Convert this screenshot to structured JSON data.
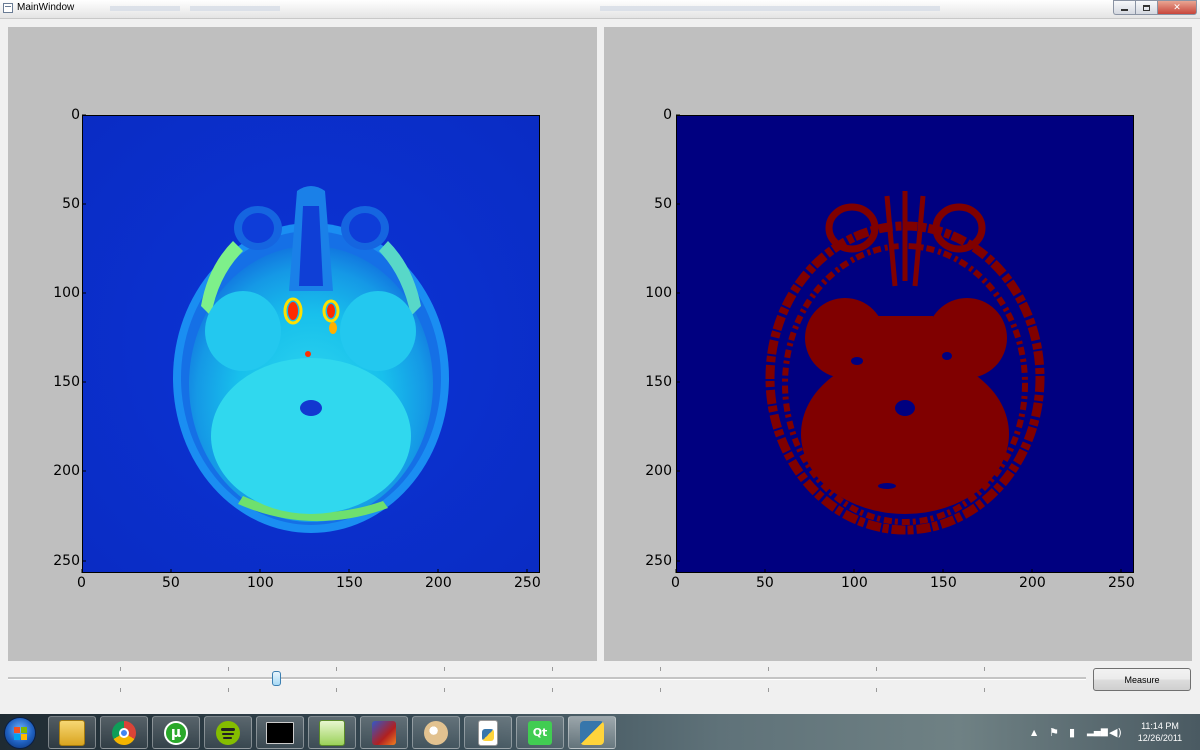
{
  "window": {
    "title": "MainWindow"
  },
  "plots": [
    {
      "name": "mri-original",
      "x_ticks": [
        "0",
        "50",
        "100",
        "150",
        "200",
        "250"
      ],
      "y_ticks": [
        "0",
        "50",
        "100",
        "150",
        "200",
        "250"
      ],
      "colormap": "jet",
      "background_color": "#0b2fcf"
    },
    {
      "name": "mri-threshold",
      "x_ticks": [
        "0",
        "50",
        "100",
        "150",
        "200",
        "250"
      ],
      "y_ticks": [
        "0",
        "50",
        "100",
        "150",
        "200",
        "250"
      ],
      "colormap": "binary-jet",
      "background_color": "#000080",
      "foreground_color": "#800000"
    }
  ],
  "axis": {
    "min": 0,
    "max": 256
  },
  "slider": {
    "value_fraction": 0.245
  },
  "measure_button": {
    "label": "Measure"
  },
  "taskbar": {
    "apps": [
      "explorer-icon",
      "chrome-icon",
      "utorrent-icon",
      "spotify-icon",
      "cmd-icon",
      "notepad-plus-icon",
      "matlab-icon",
      "paint-icon",
      "python-file-icon",
      "qt-icon",
      "python-icon"
    ],
    "clock_time": "11:14 PM",
    "clock_date": "12/26/2011"
  }
}
